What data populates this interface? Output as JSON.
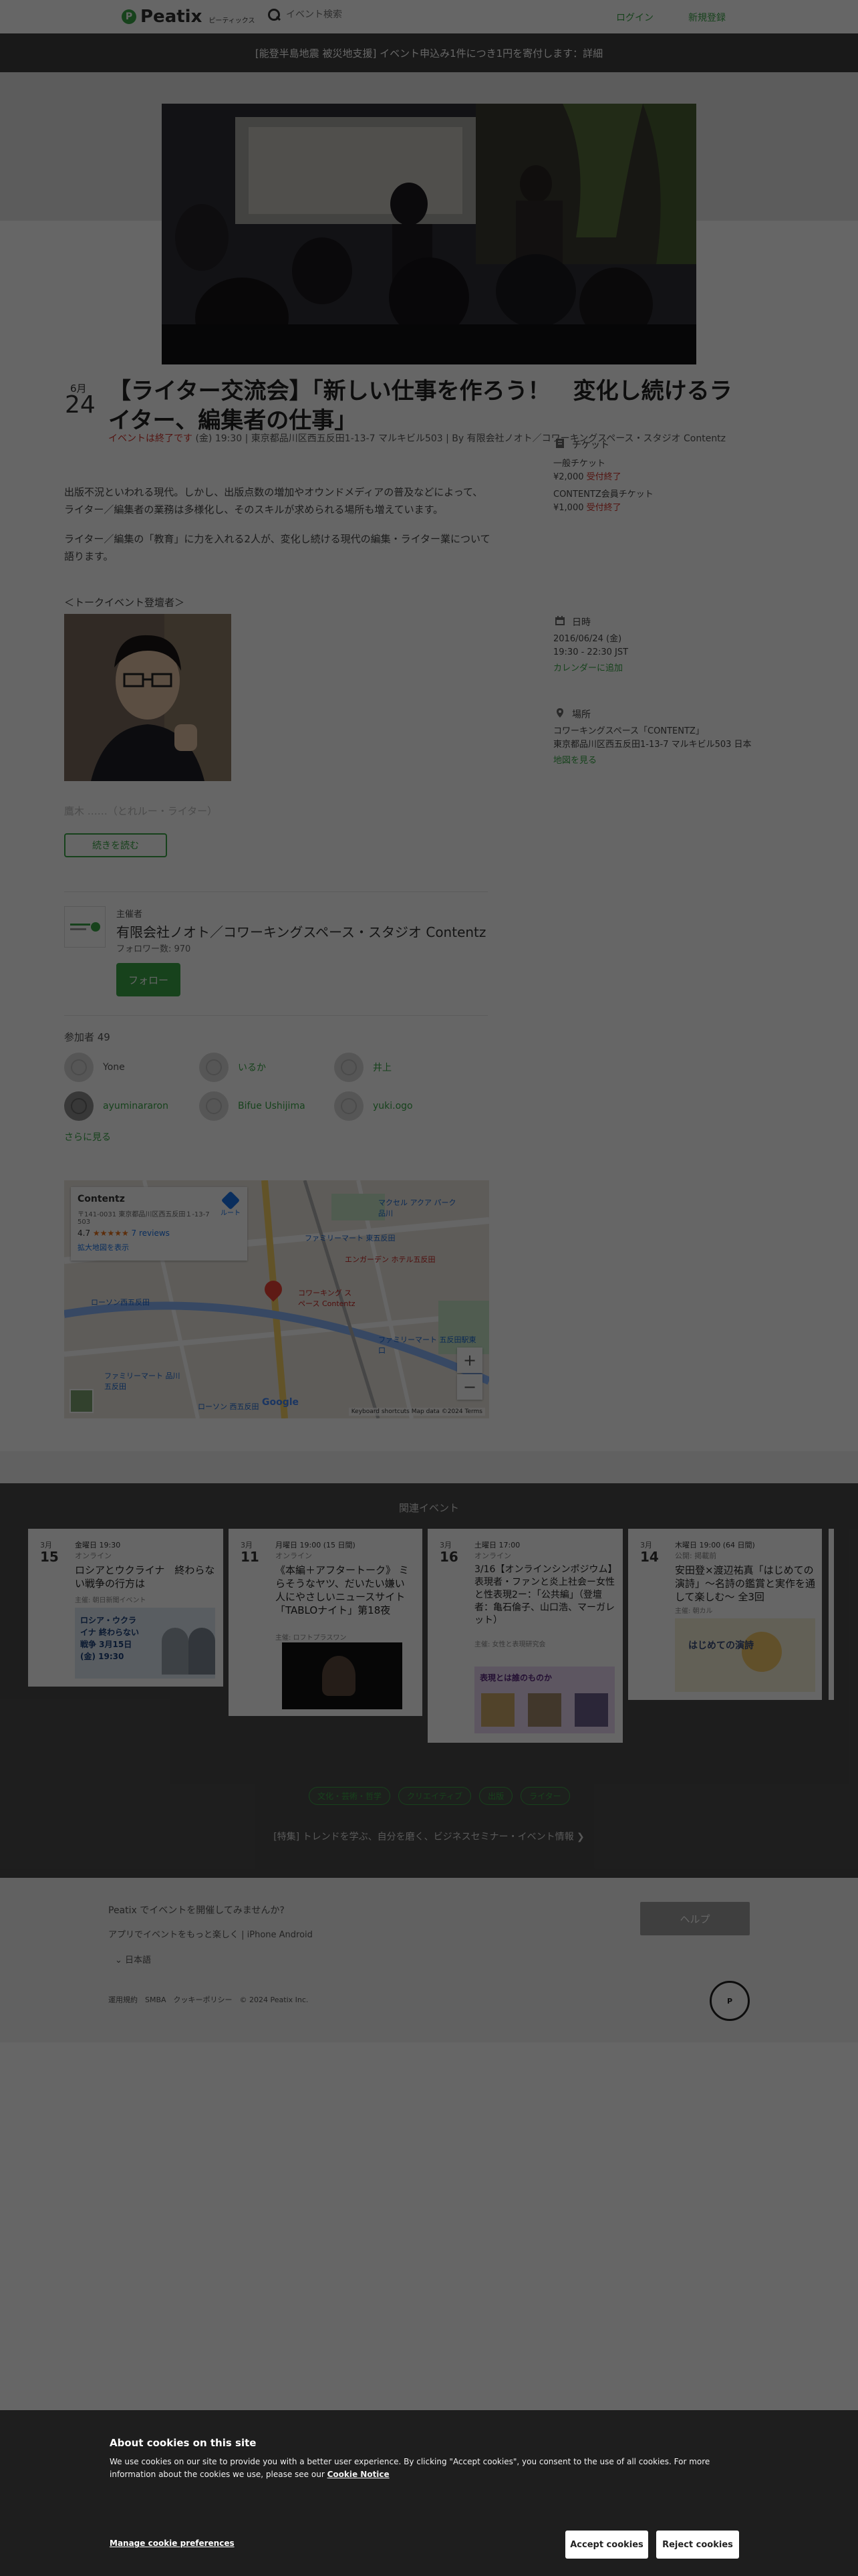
{
  "header": {
    "logo": "Peatix",
    "logo_sub": "ピーティックス",
    "search_placeholder": "イベント検索",
    "login": "ログイン",
    "signup": "新規登録"
  },
  "banner": "[能登半島地震 被災地支援] イベント申込み1件につき1円を寄付します：詳細",
  "event": {
    "month": "6月",
    "day": "24",
    "title": "【ライター交流会】「新しい仕事を作ろう！　変化し続けるライター、編集者の仕事」",
    "ended": "イベントは終了です",
    "meta": " (金) 19:30 | 東京都品川区西五反田1-13-7 マルキビル503 | By 有限会社ノオト／コワーキングスペース・スタジオ Contentz",
    "desc1": "出版不況といわれる現代。しかし、出版点数の増加やオウンドメディアの普及などによって、ライター／編集者の業務は多様化し、そのスキルが求められる場所も増えています。",
    "desc2": "ライター／編集の「教育」に力を入れる2人が、変化し続ける現代の編集・ライター業について語ります。",
    "speaker_heading": "＜トークイベント登壇者＞",
    "speaker_fade": "鷹木 ……（とれルー・ライター）",
    "more_button": "続きを読む"
  },
  "organizer": {
    "label": "主催者",
    "name": "有限会社ノオト／コワーキングスペース・スタジオ Contentz",
    "followers": "フォロワー数: 970",
    "follow_button": "フォロー"
  },
  "attendees": {
    "label": "参加者 49",
    "list": [
      {
        "name": "Yone"
      },
      {
        "name": "いるか"
      },
      {
        "name": "井上"
      },
      {
        "name": "ayuminararon"
      },
      {
        "name": "Bifue Ushijima"
      },
      {
        "name": "yuki.ogo"
      }
    ],
    "see_more": "さらに見る"
  },
  "map": {
    "place": "Contentz",
    "address1": "〒141-0031 東京都品川区西五反田１-13-7",
    "address2": "503",
    "rating": "4.7",
    "stars": "★★★★★",
    "reviews": "7 reviews",
    "view_larger": "拡大地図を表示",
    "directions": "ルート",
    "zoom_in": "+",
    "zoom_out": "−",
    "google": "Google",
    "copyright": "Keyboard shortcuts  Map data ©2024  Terms",
    "labels": [
      "マクセル アクア パーク品川",
      "ファミリーマート 東五反田",
      "エンガーデン ホテル五反田",
      "コワーキング スペース Contentz",
      "ローソン西五反田",
      "ファミリーマート 五反田駅東口",
      "ファミリーマート 品川五反田",
      "ローソン 西五反田"
    ]
  },
  "sidebar": {
    "ticket_head": "チケット",
    "ticket1_name": "一般チケット",
    "ticket1_price": "¥2,000",
    "ticket1_status": "受付終了",
    "ticket2_name": "CONTENTZ会員チケット",
    "ticket2_price": "¥1,000",
    "ticket2_status": "受付終了",
    "date_head": "日時",
    "date": "2016/06/24 (金)",
    "time": "19:30 - 22:30 JST",
    "calendar": "カレンダーに追加",
    "place_head": "場所",
    "venue": "コワーキングスペース「CONTENTZ」",
    "address": "東京都品川区西五反田1-13-7 マルキビル503 日本",
    "map_link": "地図を見る"
  },
  "related": {
    "title": "関連イベント",
    "cards": [
      {
        "month": "3月",
        "day": "15",
        "when": "金曜日 19:30",
        "where": "オンライン",
        "title": "ロシアとウクライナ　終わらない戦争の行方は",
        "org": "主催: 朝日新聞イベント",
        "thumb_text": "ロシア・ウクライナ 終わらない戦争 3月15日(金) 19:30"
      },
      {
        "month": "3月",
        "day": "11",
        "when": "月曜日 19:00 (15 日間)",
        "where": "オンライン",
        "title": "《本編＋アフタートーク》 ミらそうなヤツ、だいたい嫌い　人にやさしいニュースサイト「TABLOナイト」第18夜",
        "org": "主催: ロフトプラスワン",
        "thumb_text": ""
      },
      {
        "month": "3月",
        "day": "16",
        "when": "土曜日 17:00",
        "where": "オンライン",
        "title": "3/16【オンラインシンポジウム】表現者・ファンと炎上社会ー女性と性表現2ー：「公共編」（登壇者：亀石倫子、山口浩、マーガレット）",
        "org": "主催: 女性と表現研究会",
        "thumb_text": "表現とは誰のものか"
      },
      {
        "month": "3月",
        "day": "14",
        "when": "木曜日 19:00 (64 日間)",
        "where": "公開: 掲載前",
        "title": "安田登×渡辺祐真「はじめての演詩」〜名詩の鑑賞と実作を通して楽しむ〜 全3回",
        "org": "主催: 朝カル",
        "thumb_text": "はじめての演詩"
      }
    ],
    "tags": [
      "文化・芸術・哲学",
      "クリエイティブ",
      "出版",
      "ライター"
    ],
    "featured": "[特集] トレンドを学ぶ、自分を磨く、ビジネスセミナー・イベント情報 ❯"
  },
  "footer": {
    "host_prompt": "Peatix でイベントを開催してみませんか?",
    "app_prompt": "アプリでイベントをもっと楽しく | iPhone Android",
    "lang": "日本語",
    "help": "ヘルプ",
    "links": "運用規約　SMBA　クッキーポリシー　© 2024 Peatix Inc.",
    "privacy_mark": "P"
  },
  "cookie": {
    "title": "About cookies on this site",
    "text": "We use cookies on our site to provide you with a better user experience. By clicking \"Accept cookies\", you consent to the use of all cookies. For more information about the cookies we use, please see our ",
    "notice": "Cookie Notice",
    "manage": "Manage cookie preferences",
    "accept": "Accept cookies",
    "reject": "Reject cookies"
  },
  "colors": {
    "brand_green": "#3aa648",
    "ended_red": "#d0342c",
    "overlay": "rgba(0,0,0,0.6)",
    "cookie_bg": "#1e1e1e"
  }
}
